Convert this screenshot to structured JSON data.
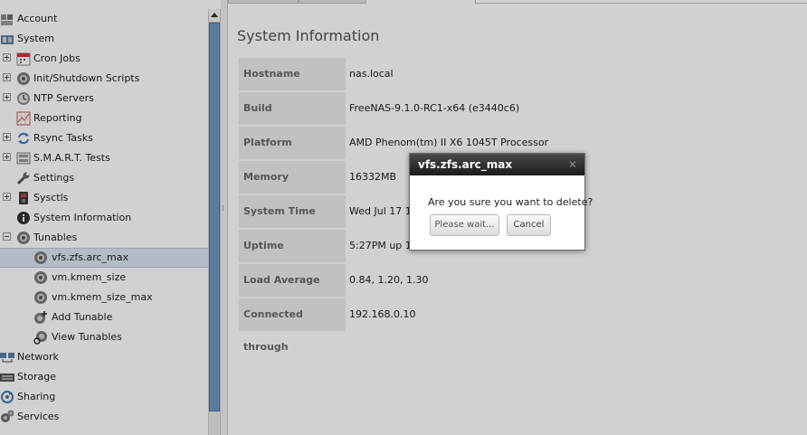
{
  "tree": {
    "items": [
      {
        "label": "Account",
        "icon": "users-icon"
      },
      {
        "label": "System",
        "icon": "system-icon"
      },
      {
        "label": "Cron Jobs",
        "icon": "calendar-icon"
      },
      {
        "label": "Init/Shutdown Scripts",
        "icon": "gear-icon"
      },
      {
        "label": "NTP Servers",
        "icon": "clock-icon"
      },
      {
        "label": "Reporting",
        "icon": "chart-icon"
      },
      {
        "label": "Rsync Tasks",
        "icon": "sync-icon"
      },
      {
        "label": "S.M.A.R.T. Tests",
        "icon": "disk-icon"
      },
      {
        "label": "Settings",
        "icon": "wrench-icon"
      },
      {
        "label": "Sysctls",
        "icon": "device-icon"
      },
      {
        "label": "System Information",
        "icon": "info-icon"
      },
      {
        "label": "Tunables",
        "icon": "gear-icon"
      },
      {
        "label": "vfs.zfs.arc_max",
        "icon": "gear-icon"
      },
      {
        "label": "vm.kmem_size",
        "icon": "gear-icon"
      },
      {
        "label": "vm.kmem_size_max",
        "icon": "gear-icon"
      },
      {
        "label": "Add Tunable",
        "icon": "add-gear-icon"
      },
      {
        "label": "View Tunables",
        "icon": "view-gear-icon"
      },
      {
        "label": "Network",
        "icon": "network-icon"
      },
      {
        "label": "Storage",
        "icon": "storage-icon"
      },
      {
        "label": "Sharing",
        "icon": "share-icon"
      },
      {
        "label": "Services",
        "icon": "services-icon"
      }
    ]
  },
  "main": {
    "title": "System Information",
    "rows": [
      {
        "key": "Hostname",
        "value": "nas.local"
      },
      {
        "key": "Build",
        "value": "FreeNAS-9.1.0-RC1-x64 (e3440c6)"
      },
      {
        "key": "Platform",
        "value": "AMD Phenom(tm) II X6 1045T Processor"
      },
      {
        "key": "Memory",
        "value": "16332MB"
      },
      {
        "key": "System Time",
        "value": "Wed Jul 17 17:"
      },
      {
        "key": "Uptime",
        "value": "5:27PM up 1 d"
      },
      {
        "key": "Load Average",
        "value": "0.84, 1.20, 1.30"
      },
      {
        "key": "Connected through",
        "value": "192.168.0.10"
      }
    ]
  },
  "dialog": {
    "title": "vfs.zfs.arc_max",
    "message": "Are you sure you want to delete?",
    "wait_label": "Please wait...",
    "cancel_label": "Cancel"
  },
  "colors": {
    "selection": "#dbe6f2",
    "scroll_thumb": "#6e98c6",
    "dialog_title_bg": "#1b1b1b"
  }
}
